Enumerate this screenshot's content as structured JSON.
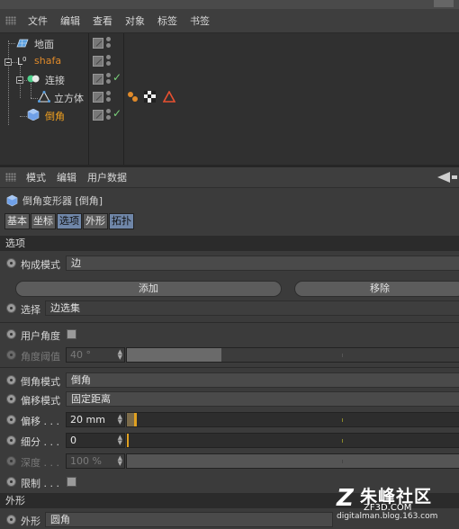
{
  "object_manager": {
    "menu": [
      "文件",
      "编辑",
      "查看",
      "对象",
      "标签",
      "书签"
    ],
    "objects": [
      {
        "name": "地面",
        "color": "#d8d8d8"
      },
      {
        "name": "shafa",
        "color": "#e08a2a"
      },
      {
        "name": "连接",
        "color": "#d8d8d8"
      },
      {
        "name": "立方体",
        "color": "#d8d8d8"
      },
      {
        "name": "倒角",
        "color": "#f0a020"
      }
    ]
  },
  "attribute_manager": {
    "menu": [
      "模式",
      "编辑",
      "用户数据"
    ],
    "object_title": "倒角变形器 [倒角]",
    "tabs": [
      "基本",
      "坐标",
      "选项",
      "外形",
      "拓扑"
    ],
    "selected_tab": "选项",
    "section_options": "选项",
    "section_shape": "外形",
    "fields": {
      "compose_mode_label": "构成模式",
      "compose_mode_value": "边",
      "add_button": "添加",
      "remove_button": "移除",
      "select_label": "选择",
      "select_value": "边选集",
      "user_angle_label": "用户角度",
      "angle_threshold_label": "角度阈值",
      "angle_threshold_value": "40 °",
      "bevel_mode_label": "倒角模式",
      "bevel_mode_value": "倒角",
      "offset_mode_label": "偏移模式",
      "offset_mode_value": "固定距离",
      "offset_label": "偏移 . . .",
      "offset_value": "20 mm",
      "subdivision_label": "细分 . . .",
      "subdivision_value": "0",
      "depth_label": "深度 . . .",
      "depth_value": "100 %",
      "limit_label": "限制 . . .",
      "shape_label": "外形",
      "shape_value": "圆角"
    }
  },
  "watermark": {
    "title": "朱峰社区",
    "site": "ZF3D.COM",
    "blog": "digitalman.blog.163.com"
  }
}
